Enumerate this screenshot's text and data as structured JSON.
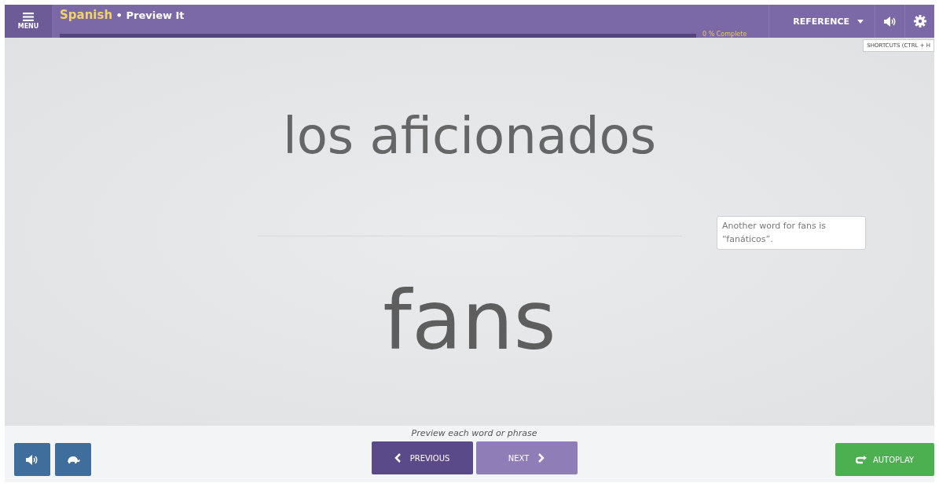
{
  "header": {
    "menu_label": "MENU",
    "course": "Spanish",
    "separator": "•",
    "activity": "Preview It",
    "progress": {
      "level": 0,
      "label": "0 % Complete"
    },
    "reference": "REFERENCE",
    "shortcuts_tooltip": "SHORTCUTS (CTRL + H"
  },
  "card": {
    "term": "los aficionados",
    "translation": "fans",
    "note": "Another word for fans is “fanáticos”."
  },
  "footer": {
    "instruction": "Preview each word or phrase",
    "previous": "PREVIOUS",
    "next": "NEXT",
    "autoplay": "AUTOPLAY"
  }
}
